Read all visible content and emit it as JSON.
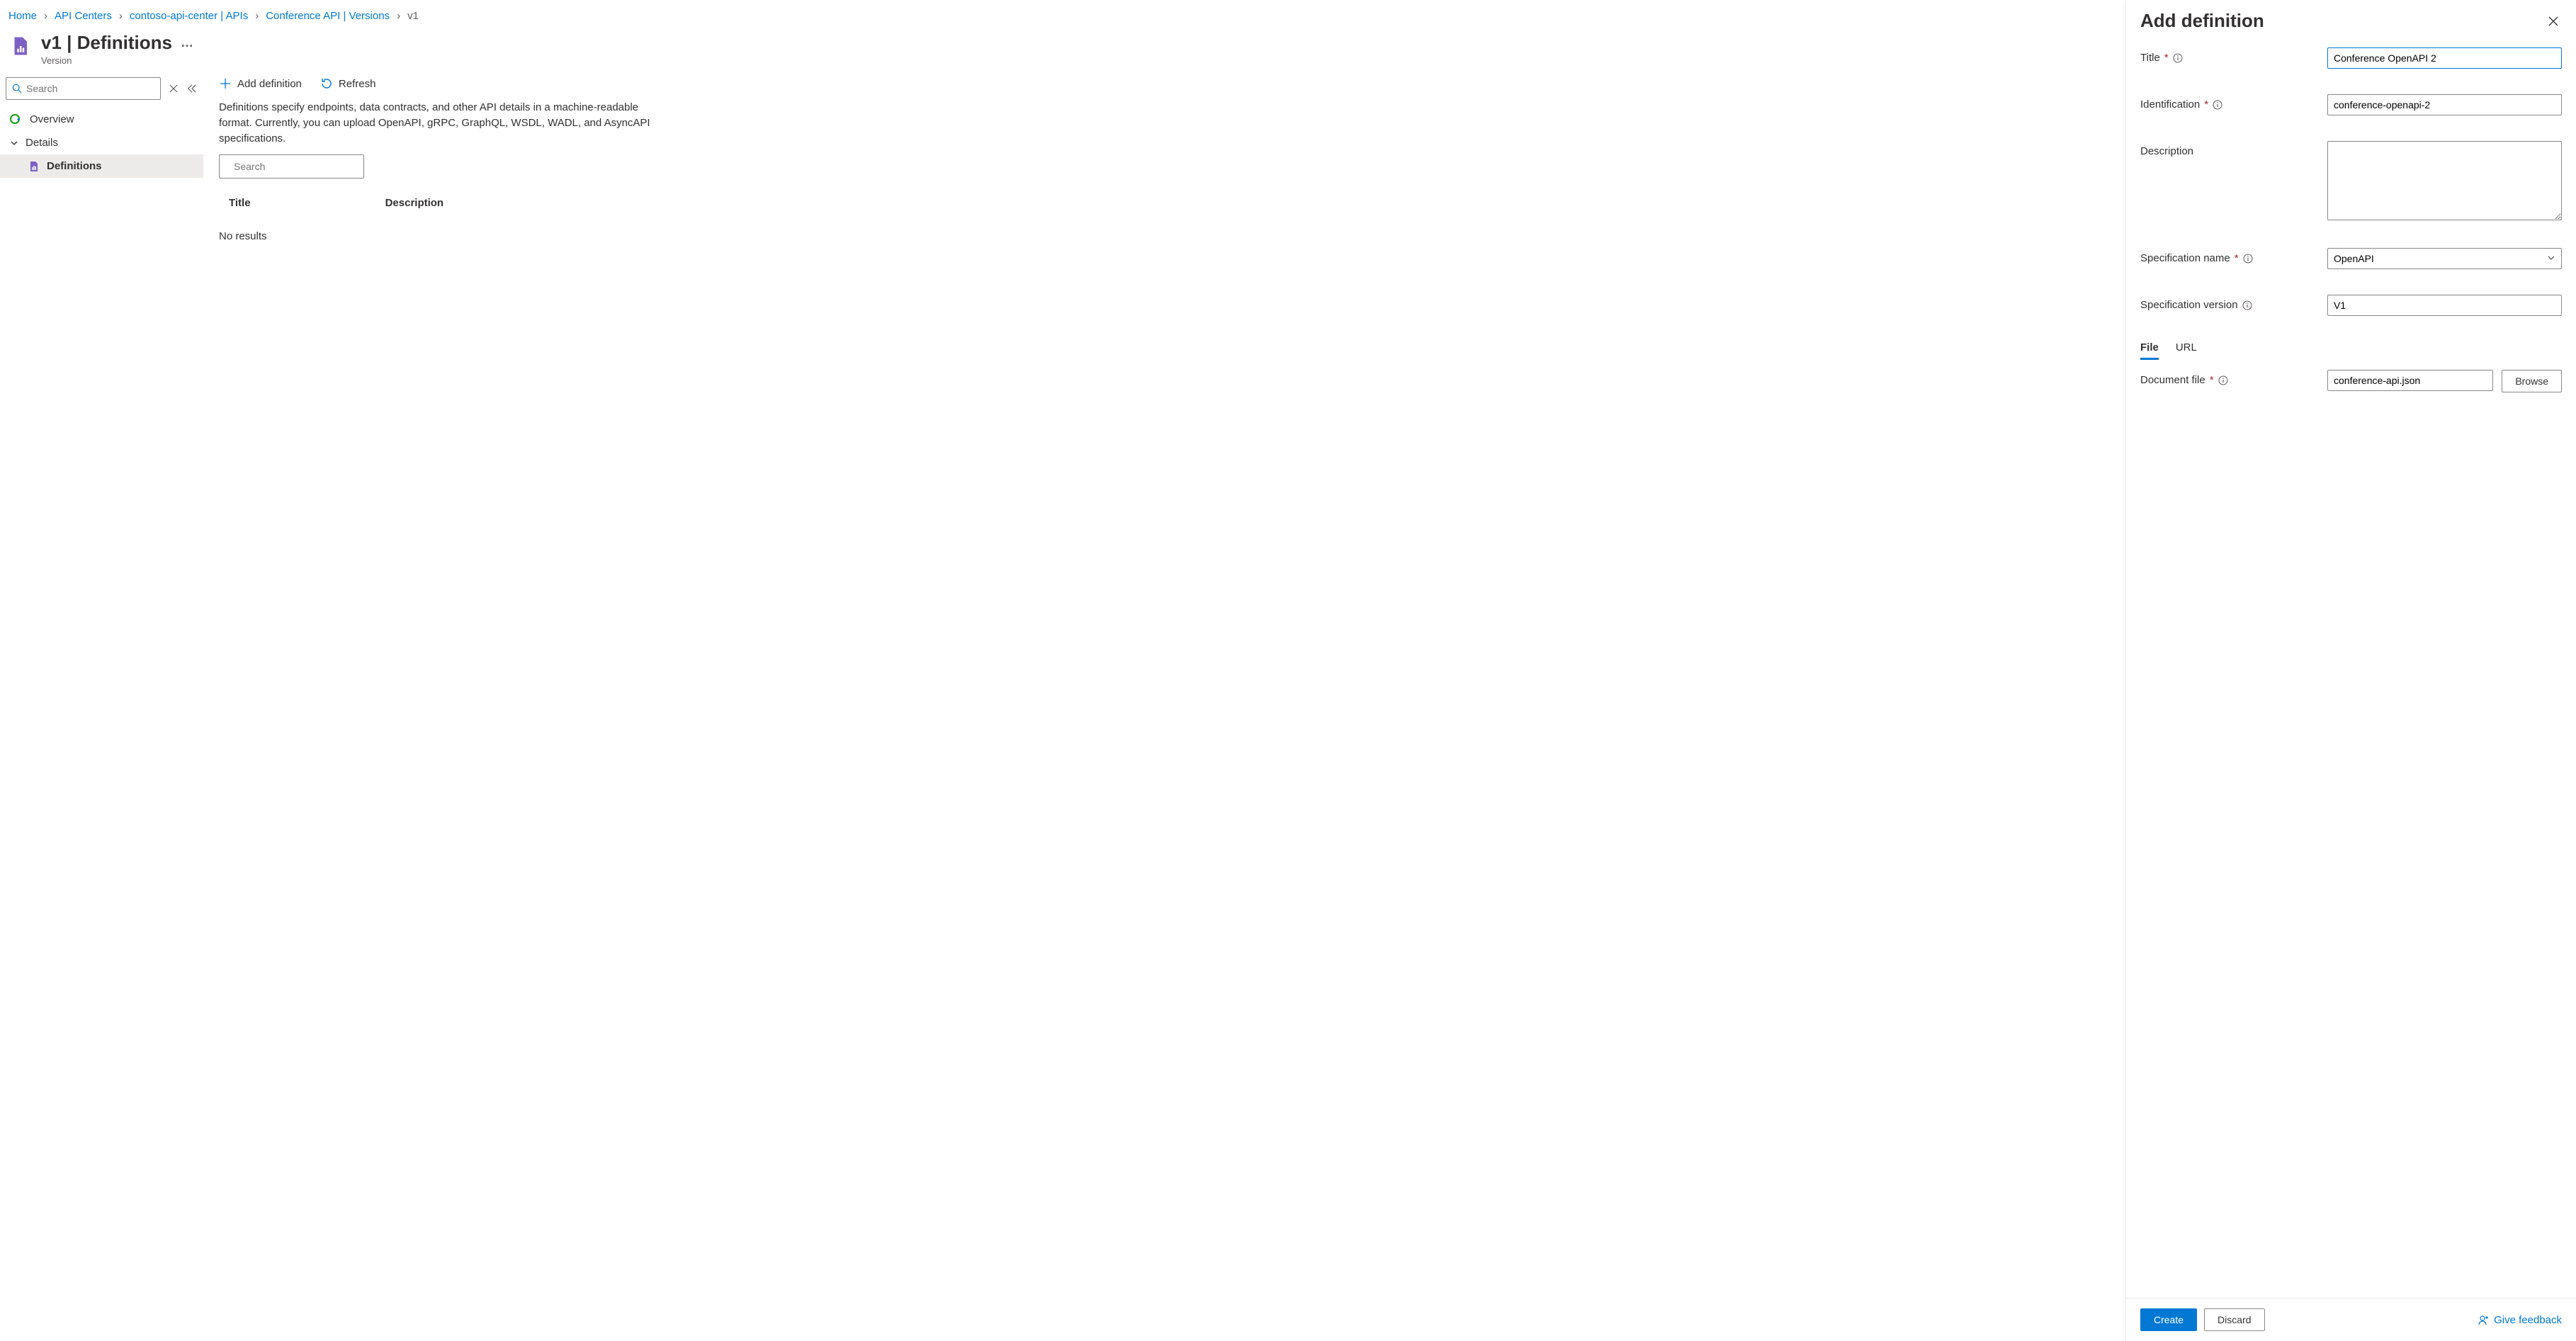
{
  "breadcrumbs": {
    "home": "Home",
    "api_centers": "API Centers",
    "center": "contoso-api-center | APIs",
    "api": "Conference API | Versions",
    "version": "v1"
  },
  "header": {
    "title": "v1 | Definitions",
    "subtitle": "Version"
  },
  "sidebar": {
    "search_placeholder": "Search",
    "overview": "Overview",
    "details": "Details",
    "definitions": "Definitions"
  },
  "toolbar": {
    "add_definition": "Add definition",
    "refresh": "Refresh"
  },
  "main": {
    "description": "Definitions specify endpoints, data contracts, and other API details in a machine-readable format. Currently, you can upload OpenAPI, gRPC, GraphQL, WSDL, WADL, and AsyncAPI specifications.",
    "search_placeholder": "Search",
    "col_title": "Title",
    "col_description": "Description",
    "no_results": "No results"
  },
  "panel": {
    "title": "Add definition",
    "fields": {
      "title_label": "Title",
      "title_value": "Conference OpenAPI 2",
      "identification_label": "Identification",
      "identification_value": "conference-openapi-2",
      "description_label": "Description",
      "description_value": "",
      "spec_name_label": "Specification name",
      "spec_name_value": "OpenAPI",
      "spec_version_label": "Specification version",
      "spec_version_value": "V1",
      "doc_file_label": "Document file",
      "doc_file_value": "conference-api.json",
      "browse": "Browse"
    },
    "tabs": {
      "file": "File",
      "url": "URL"
    },
    "buttons": {
      "create": "Create",
      "discard": "Discard",
      "feedback": "Give feedback"
    }
  }
}
